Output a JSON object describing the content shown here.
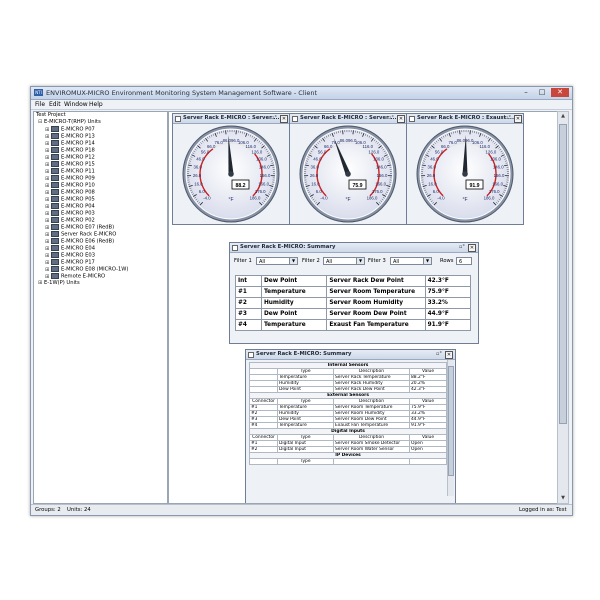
{
  "window": {
    "app_icon": "NTI",
    "title": "ENVIROMUX-MICRO Environment Monitoring System Management Software - Client",
    "controls": [
      "–",
      "□",
      "✕"
    ]
  },
  "menu": [
    "File",
    "Edit",
    "Window",
    "Help"
  ],
  "tree": {
    "root": "Test Project",
    "items": [
      {
        "label": "E-MICRO-T(RHP) Units",
        "level": 1,
        "toggle": "⊟",
        "unit": false
      },
      {
        "label": "E-MICRO P07",
        "level": 2,
        "toggle": "⊞",
        "unit": true
      },
      {
        "label": "E-MICRO P13",
        "level": 2,
        "toggle": "⊞",
        "unit": true
      },
      {
        "label": "E-MICRO P14",
        "level": 2,
        "toggle": "⊞",
        "unit": true
      },
      {
        "label": "E-MICRO P18",
        "level": 2,
        "toggle": "⊞",
        "unit": true
      },
      {
        "label": "E-MICRO P12",
        "level": 2,
        "toggle": "⊞",
        "unit": true
      },
      {
        "label": "E-MICRO P15",
        "level": 2,
        "toggle": "⊞",
        "unit": true
      },
      {
        "label": "E-MICRO P11",
        "level": 2,
        "toggle": "⊞",
        "unit": true
      },
      {
        "label": "E-MICRO P09",
        "level": 2,
        "toggle": "⊞",
        "unit": true
      },
      {
        "label": "E-MICRO P10",
        "level": 2,
        "toggle": "⊞",
        "unit": true
      },
      {
        "label": "E-MICRO P08",
        "level": 2,
        "toggle": "⊞",
        "unit": true
      },
      {
        "label": "E-MICRO P05",
        "level": 2,
        "toggle": "⊞",
        "unit": true
      },
      {
        "label": "E-MICRO P04",
        "level": 2,
        "toggle": "⊞",
        "unit": true
      },
      {
        "label": "E-MICRO P03",
        "level": 2,
        "toggle": "⊞",
        "unit": true
      },
      {
        "label": "E-MICRO P02",
        "level": 2,
        "toggle": "⊞",
        "unit": true
      },
      {
        "label": "E-MICRO E07 (RedB)",
        "level": 2,
        "toggle": "⊞",
        "unit": true
      },
      {
        "label": "Server Rack E-MICRO",
        "level": 2,
        "toggle": "⊞",
        "unit": true
      },
      {
        "label": "E-MICRO E06 (RedB)",
        "level": 2,
        "toggle": "⊞",
        "unit": true
      },
      {
        "label": "E-MICRO E04",
        "level": 2,
        "toggle": "⊞",
        "unit": true
      },
      {
        "label": "E-MICRO E03",
        "level": 2,
        "toggle": "⊞",
        "unit": true
      },
      {
        "label": "E-MICRO P17",
        "level": 2,
        "toggle": "⊞",
        "unit": true
      },
      {
        "label": "E-MICRO E08 (MICRO-1W)",
        "level": 2,
        "toggle": "⊞",
        "unit": true
      },
      {
        "label": "Remote E-MICRO",
        "level": 2,
        "toggle": "⊞",
        "unit": true
      },
      {
        "label": "E-1W(P) Units",
        "level": 1,
        "toggle": "⊞",
        "unit": false
      }
    ]
  },
  "gauges": [
    {
      "title": "Server Rack E-MICRO : Server ...",
      "value": 88.2,
      "display": "88.2",
      "unit": "°F",
      "min": -4,
      "max": 186,
      "labels": [
        "-4.0",
        "6.0",
        "16.0",
        "26.0",
        "36.0",
        "46.0",
        "56.0",
        "66.0",
        "76.0",
        "86.0",
        "96.0",
        "106.0",
        "116.0",
        "126.0",
        "136.0",
        "146.0",
        "156.0",
        "166.0",
        "176.0",
        "186.0"
      ]
    },
    {
      "title": "Server Rack E-MICRO : Server ...",
      "value": 75.9,
      "display": "75.9",
      "unit": "°F",
      "min": -4,
      "max": 186,
      "labels": [
        "-4.0",
        "6.0",
        "16.0",
        "26.0",
        "36.0",
        "46.0",
        "56.0",
        "66.0",
        "76.0",
        "86.0",
        "96.0",
        "106.0",
        "116.0",
        "126.0",
        "136.0",
        "146.0",
        "156.0",
        "166.0",
        "176.0",
        "186.0"
      ]
    },
    {
      "title": "Server Rack E-MICRO : Exaust ...",
      "value": 91.9,
      "display": "91.9",
      "unit": "°F",
      "min": -4,
      "max": 186,
      "labels": [
        "-4.0",
        "6.0",
        "16.0",
        "26.0",
        "36.0",
        "46.0",
        "56.0",
        "66.0",
        "76.0",
        "86.0",
        "96.0",
        "106.0",
        "116.0",
        "126.0",
        "136.0",
        "146.0",
        "156.0",
        "166.0",
        "176.0",
        "186.0"
      ]
    }
  ],
  "summary": {
    "title": "Server Rack E-MICRO: Summary",
    "filter1_label": "Filter 1",
    "filter1_value": "All",
    "filter2_label": "Filter 2",
    "filter2_value": "All",
    "filter3_label": "Filter 3",
    "filter3_value": "All",
    "rows_label": "Rows",
    "rows_value": "6",
    "rows": [
      [
        "Int",
        "Dew Point",
        "Server Rack Dew Point",
        "42.3°F"
      ],
      [
        "#1",
        "Temperature",
        "Server Room Temperature",
        "75.9°F"
      ],
      [
        "#2",
        "Humidity",
        "Server Room Humidity",
        "33.2%"
      ],
      [
        "#3",
        "Dew Point",
        "Server Room Dew Point",
        "44.9°F"
      ],
      [
        "#4",
        "Temperature",
        "Exaust Fan Temperature",
        "91.9°F"
      ]
    ]
  },
  "detail": {
    "title": "Server Rack E-MICRO: Summary",
    "internal": {
      "section": "Internal Sensors",
      "headers": [
        "",
        "Type",
        "Description",
        "Value"
      ],
      "rows": [
        [
          "",
          "Temperature",
          "Server Rack Temperature",
          "88.2°F"
        ],
        [
          "",
          "Humidity",
          "Server Rack Humidity",
          "20.2%"
        ],
        [
          "",
          "Dew Point",
          "Server Rack Dew Point",
          "42.3°F"
        ]
      ]
    },
    "external": {
      "section": "External Sensors",
      "headers": [
        "Connector",
        "Type",
        "Description",
        "Value"
      ],
      "rows": [
        [
          "#1",
          "Temperature",
          "Server Room Temperature",
          "75.9°F"
        ],
        [
          "#2",
          "Humidity",
          "Server Room Humidity",
          "33.2%"
        ],
        [
          "#3",
          "Dew Point",
          "Server Room Dew Point",
          "44.9°F"
        ],
        [
          "#4",
          "Temperature",
          "Exaust Fan Temperature",
          "91.9°F"
        ]
      ]
    },
    "digital": {
      "section": "Digital Inputs",
      "headers": [
        "Connector",
        "Type",
        "Description",
        "Value"
      ],
      "rows": [
        [
          "#1",
          "Digital Input",
          "Server Room Smoke Detector",
          "Open"
        ],
        [
          "#2",
          "Digital Input",
          "Server Room Water Sensor",
          "Open"
        ]
      ]
    },
    "ip": {
      "section": "IP Devices",
      "headers": [
        "",
        "Type",
        "",
        ""
      ]
    }
  },
  "status": {
    "groups": "Groups: 2",
    "units": "Units: 24",
    "login": "Logged in as: Test"
  }
}
